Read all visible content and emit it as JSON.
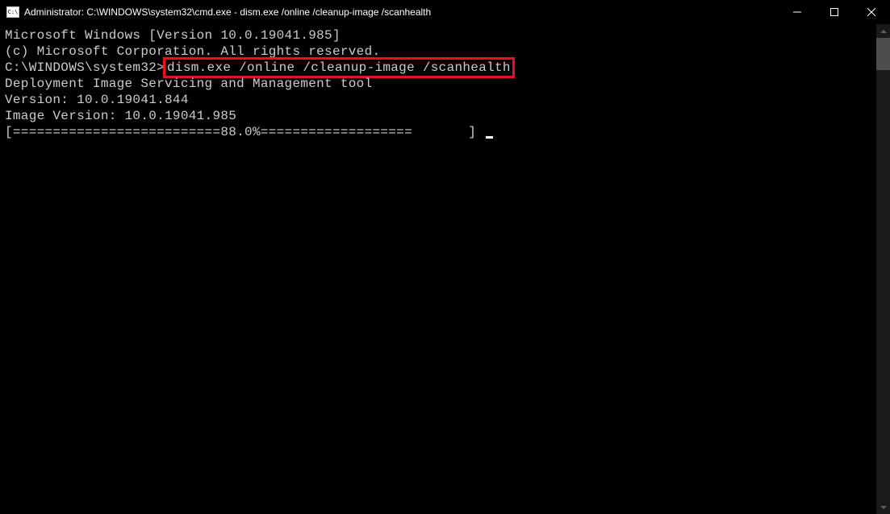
{
  "titlebar": {
    "title": "Administrator: C:\\WINDOWS\\system32\\cmd.exe - dism.exe  /online /cleanup-image /scanhealth"
  },
  "terminal": {
    "line1": "Microsoft Windows [Version 10.0.19041.985]",
    "line2": "(c) Microsoft Corporation. All rights reserved.",
    "blank1": "",
    "prompt_prefix": "C:\\WINDOWS\\system32>",
    "command": "dism.exe /online /cleanup-image /scanhealth",
    "blank2": "",
    "tool_line1": "Deployment Image Servicing and Management tool",
    "tool_line2": "Version: 10.0.19041.844",
    "blank3": "",
    "image_version": "Image Version: 10.0.19041.985",
    "blank4": "",
    "progress": "[==========================88.0%===================       ] "
  }
}
